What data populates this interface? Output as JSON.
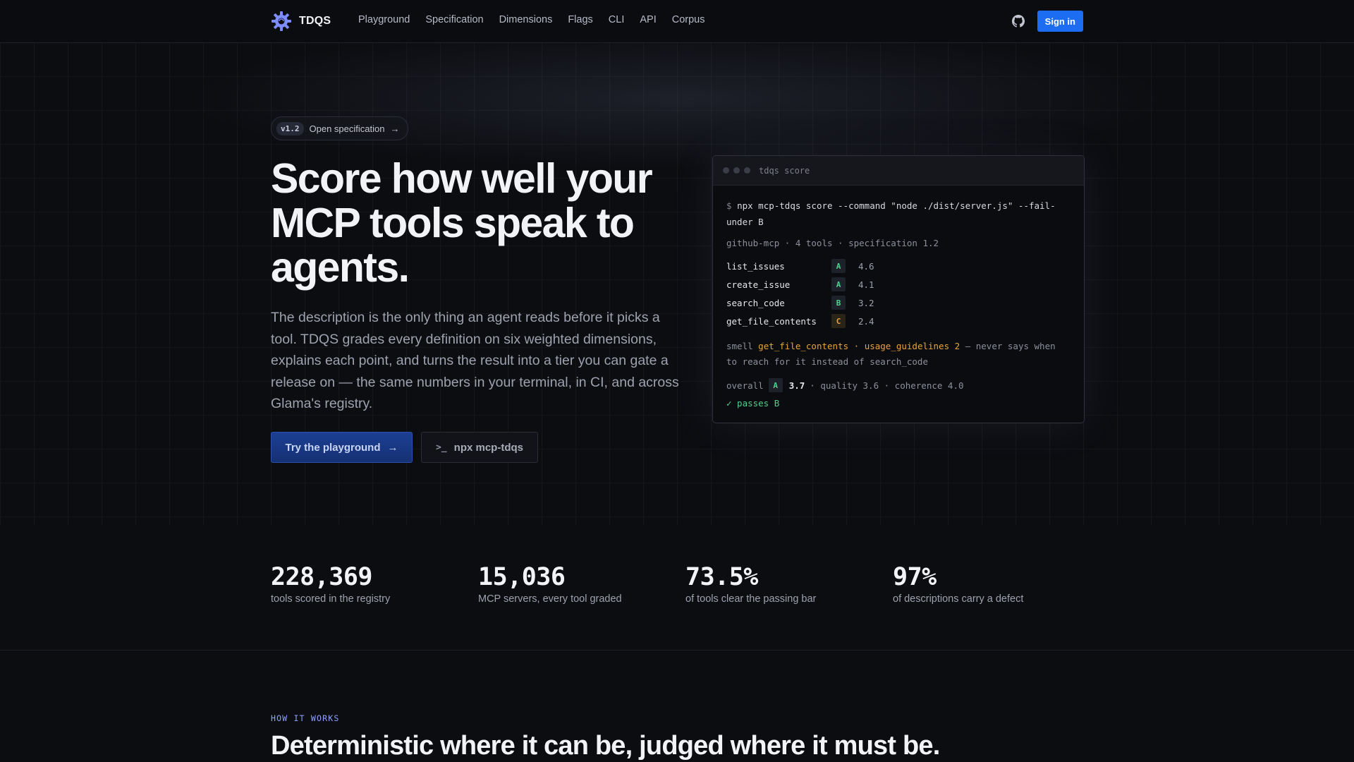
{
  "colors": {
    "background": "#0c0d11",
    "accent_blue": "#1d6df2",
    "grade_green": "#4fd08c",
    "grade_orange": "#e5a145",
    "kicker": "#8ea2ff"
  },
  "nav": {
    "brand": "TDQS",
    "logo_icon": "gear-logo-icon",
    "links": [
      "Playground",
      "Specification",
      "Dimensions",
      "Flags",
      "CLI",
      "API",
      "Corpus"
    ],
    "github_icon": "github-icon",
    "signin_label": "Sign in"
  },
  "hero": {
    "pill_version": "v1.2",
    "pill_text": "Open specification",
    "pill_arrow": "→",
    "title": "Score how well your MCP tools speak to agents.",
    "description": "The description is the only thing an agent reads before it picks a tool. TDQS grades every definition on six weighted dimensions, explains each point, and turns the result into a tier you can gate a release on — the same numbers in your terminal, in CI, and across Glama's registry.",
    "primary_button": "Try the playground",
    "primary_arrow": "→",
    "secondary_glyph": ">_",
    "secondary_button": "npx mcp-tdqs"
  },
  "terminal": {
    "title": "tdqs score",
    "prompt": "$",
    "command": "npx mcp-tdqs score --command \"node ./dist/server.js\" --fail-under B",
    "meta": "github-mcp · 4 tools · specification 1.2",
    "tools": [
      {
        "name": "list_issues",
        "grade": "A",
        "score": "4.6"
      },
      {
        "name": "create_issue",
        "grade": "A",
        "score": "4.1"
      },
      {
        "name": "search_code",
        "grade": "B",
        "score": "3.2"
      },
      {
        "name": "get_file_contents",
        "grade": "C",
        "score": "2.4"
      }
    ],
    "smell": {
      "label": "smell",
      "tool": "get_file_contents",
      "sep": "·",
      "dimension": "usage_guidelines 2",
      "message": "— never says when to reach for it instead of search_code"
    },
    "overall": {
      "label": "overall",
      "grade": "A",
      "score": "3.7",
      "details": "· quality 3.6 · coherence 4.0"
    },
    "passes": "✓ passes B"
  },
  "stats": [
    {
      "number": "228,369",
      "label": "tools scored in the registry"
    },
    {
      "number": "15,036",
      "label": "MCP servers, every tool graded"
    },
    {
      "number": "73.5%",
      "label": "of tools clear the passing bar"
    },
    {
      "number": "97%",
      "label": "of descriptions carry a defect"
    }
  ],
  "how": {
    "kicker": "HOW IT WORKS",
    "title": "Deterministic where it can be, judged where it must be."
  }
}
